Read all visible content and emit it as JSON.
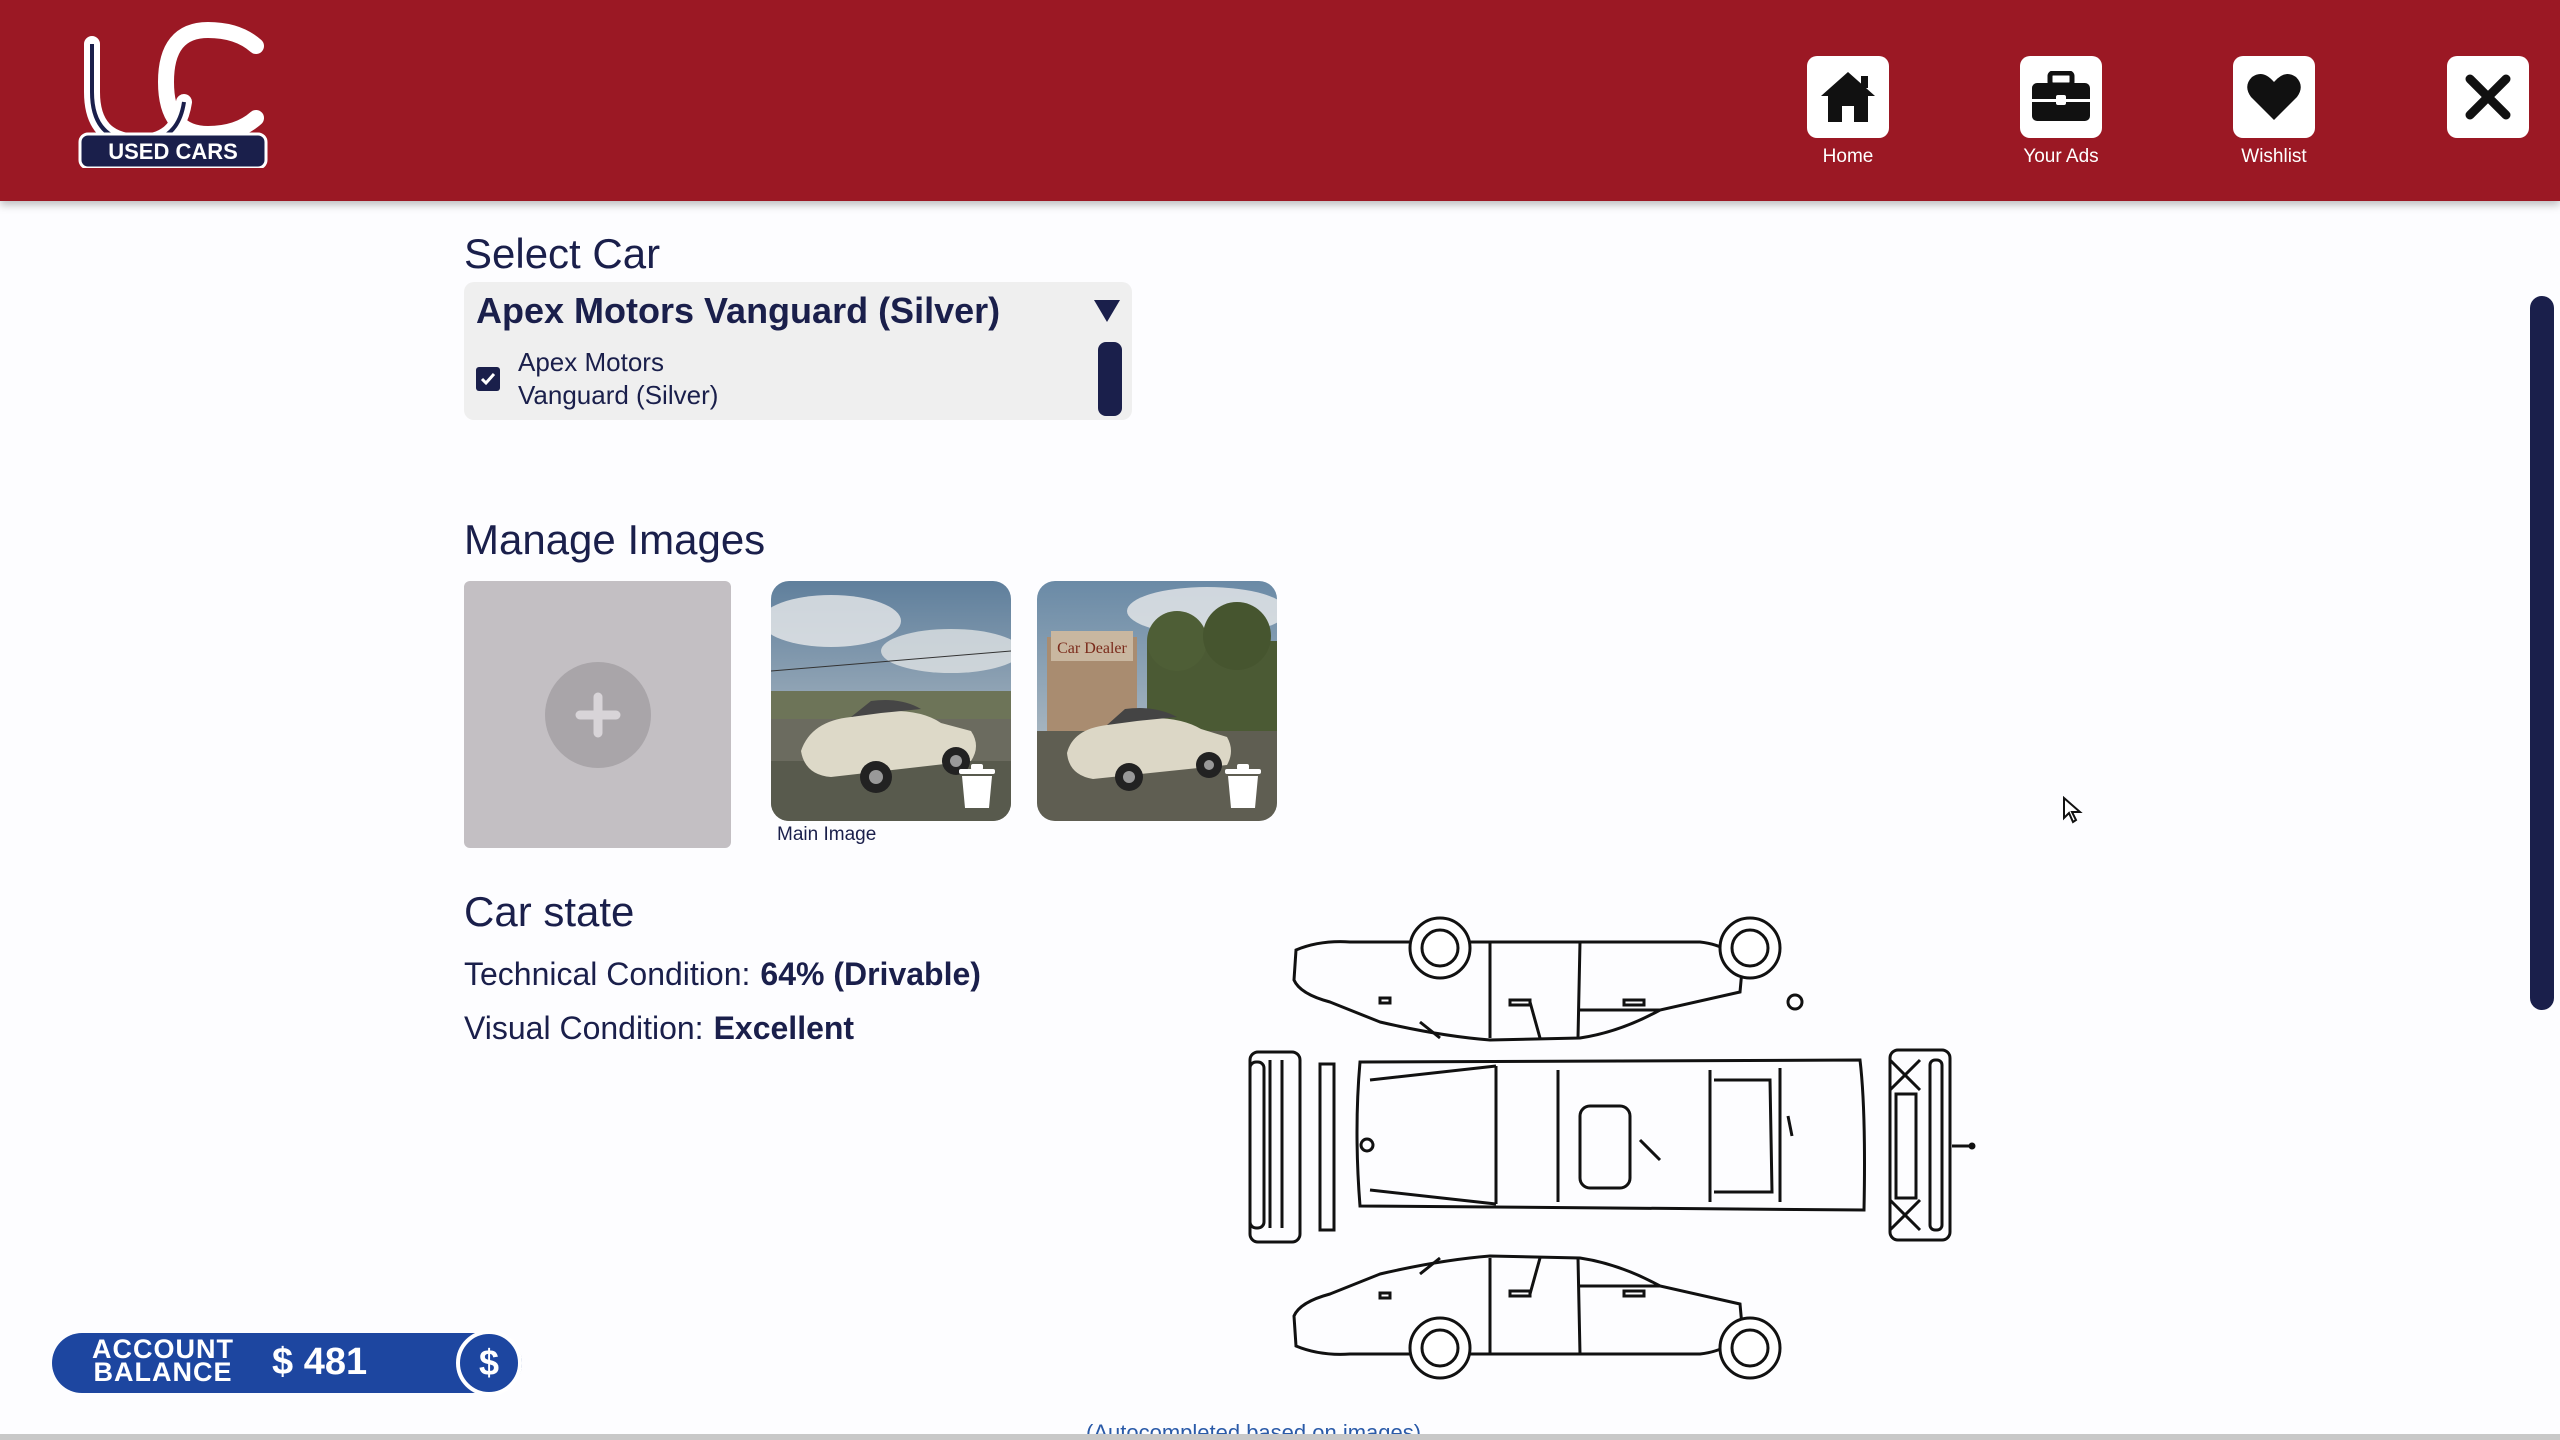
{
  "brand": {
    "logo_text": "USED CARS"
  },
  "nav": {
    "items": [
      {
        "label": "Home",
        "icon": "home-icon"
      },
      {
        "label": "Your Ads",
        "icon": "briefcase-icon"
      },
      {
        "label": "Wishlist",
        "icon": "heart-icon"
      }
    ],
    "close_icon": "close-icon"
  },
  "select_car": {
    "title": "Select Car",
    "selected": "Apex Motors Vanguard (Silver)",
    "options": [
      {
        "label": "Apex Motors Vanguard (Silver)",
        "checked": true
      }
    ]
  },
  "images": {
    "title": "Manage Images",
    "main_label": "Main Image",
    "thumb2_sign": "Car Dealer"
  },
  "car_state": {
    "title": "Car state",
    "technical_label": "Technical Condition:",
    "technical_value": "64% (Drivable)",
    "visual_label": "Visual Condition:",
    "visual_value": "Excellent",
    "note": "(Autocompleted based on images)"
  },
  "account": {
    "label_line1": "ACCOUNT",
    "label_line2": "BALANCE",
    "value": "$ 481",
    "icon_glyph": "$"
  },
  "colors": {
    "header": "#9b1824",
    "navy": "#1a1f4b",
    "balance_blue": "#1d46a0"
  }
}
